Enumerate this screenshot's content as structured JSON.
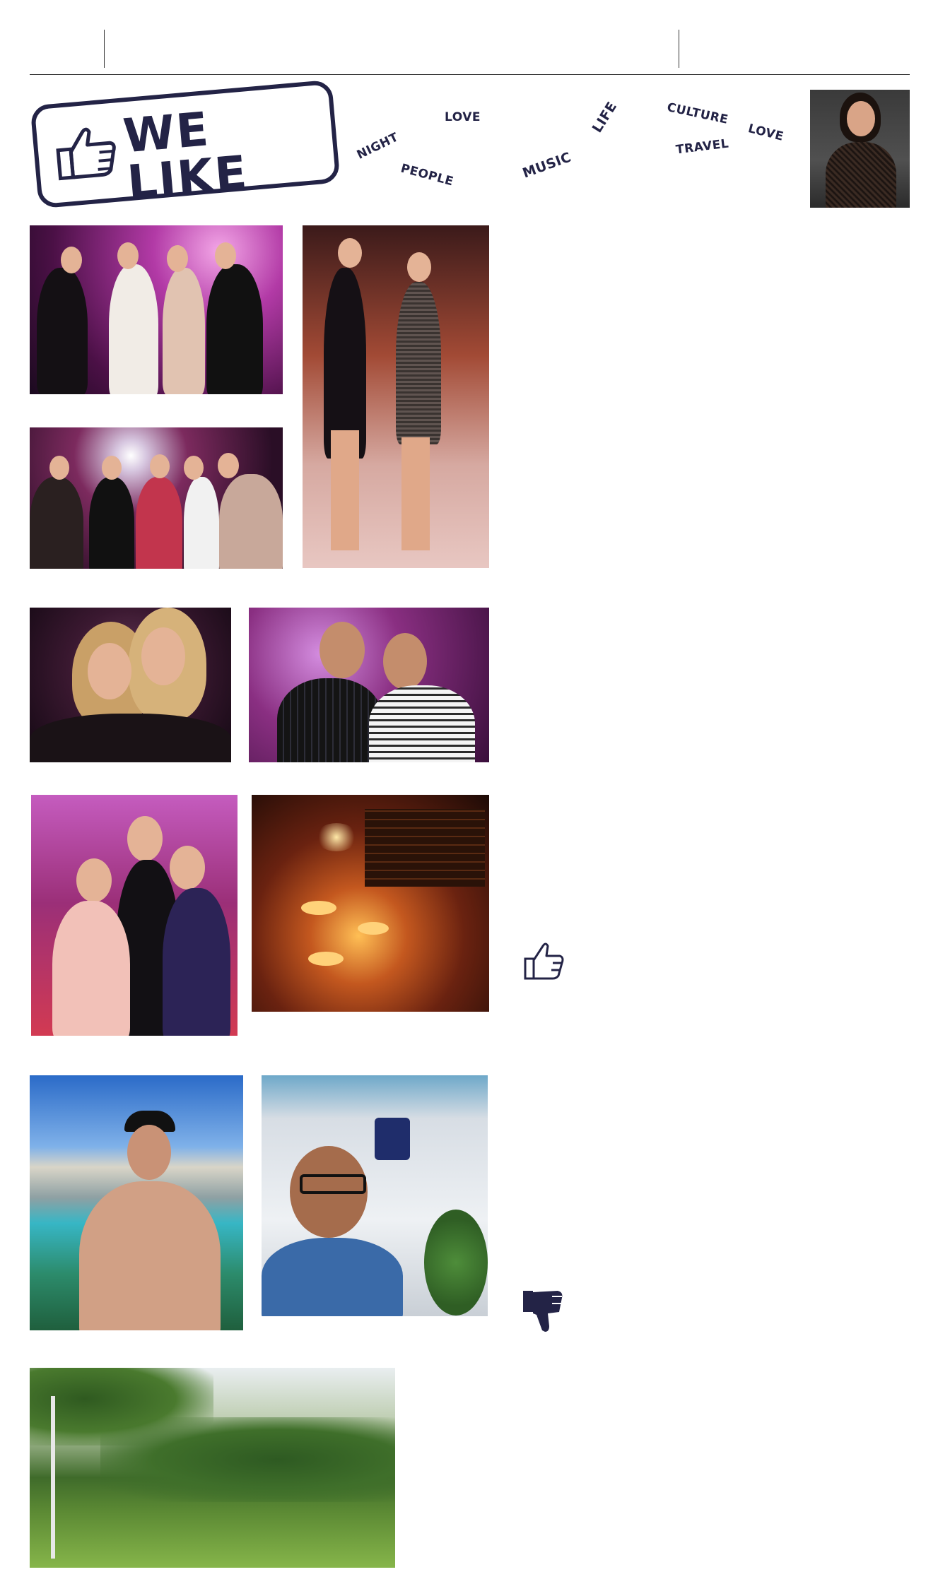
{
  "header": {
    "stamp_title": "WE LIKE"
  },
  "words": {
    "night": "NIGHT",
    "people": "PEOPLE",
    "love": "LOVE",
    "music": "MUSIC",
    "life": "LIFE",
    "culture": "CULTURE",
    "travel": "TRAVEL",
    "love2": "LOVE"
  },
  "icons": {
    "stamp_thumb": "thumbs-up-icon",
    "like": "thumbs-up-icon",
    "dislike": "thumbs-down-icon"
  },
  "colors": {
    "ink": "#232346"
  }
}
